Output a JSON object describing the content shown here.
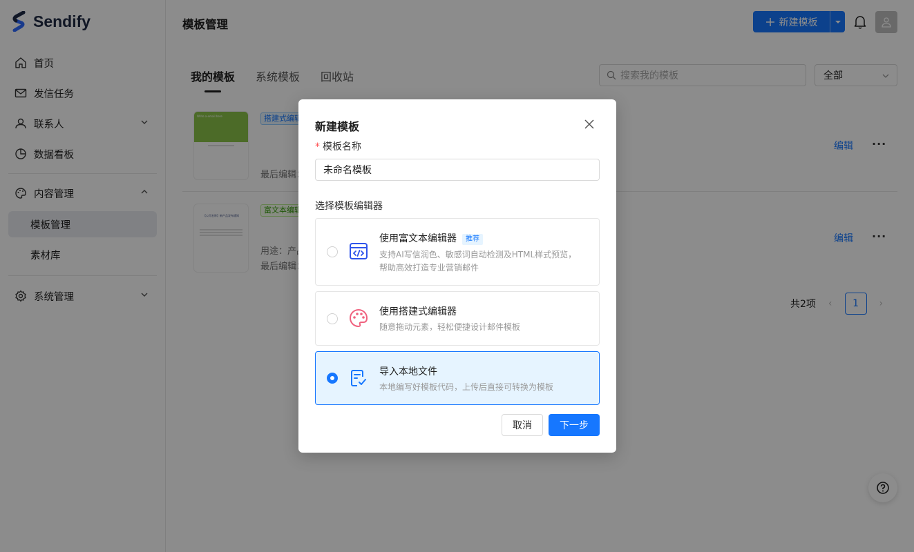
{
  "brand": {
    "name": "Sendify",
    "colors": {
      "primary": "#1677ff",
      "logo_dark": "#1f2a44",
      "logo_blue": "#2f6bff"
    }
  },
  "sidebar": {
    "items": [
      {
        "label": "首页",
        "icon": "home-icon"
      },
      {
        "label": "发信任务",
        "icon": "mail-icon"
      },
      {
        "label": "联系人",
        "icon": "user-icon"
      },
      {
        "label": "数据看板",
        "icon": "pie-chart-icon"
      },
      {
        "label": "内容管理",
        "icon": "palette-icon"
      },
      {
        "label": "模板管理"
      },
      {
        "label": "素材库"
      },
      {
        "label": "系统管理",
        "icon": "gear-icon"
      }
    ]
  },
  "header": {
    "title": "模板管理",
    "new_button_label": "新建模板"
  },
  "tabs": [
    {
      "label": "我的模板",
      "active": true
    },
    {
      "label": "系统模板"
    },
    {
      "label": "回收站"
    }
  ],
  "search": {
    "placeholder": "搜索我的模板"
  },
  "filter": {
    "value": "全部"
  },
  "templates": [
    {
      "tag": "搭建式编辑器",
      "meta": "最后编辑：",
      "edit_label": "编辑",
      "thumb_text": "Write a email here"
    },
    {
      "tag": "富文本编辑器",
      "usage": "用途：产品",
      "meta": "最后编辑：",
      "edit_label": "编辑",
      "thumb_text": "【公司名称】新产品发布通知"
    }
  ],
  "pagination": {
    "total": "共2项",
    "page": "1"
  },
  "modal": {
    "title": "新建模板",
    "name_label": "模板名称",
    "name_value": "未命名模板",
    "editor_label": "选择模板编辑器",
    "options": [
      {
        "title": "使用富文本编辑器",
        "badge": "推荐",
        "desc": "支持AI写信润色、敏感词自动检测及HTML样式预览，帮助高效打造专业营销邮件",
        "icon": "code-window-icon",
        "selected": false
      },
      {
        "title": "使用搭建式编辑器",
        "desc": "随意拖动元素，轻松便捷设计邮件模板",
        "icon": "palette-icon",
        "selected": false
      },
      {
        "title": "导入本地文件",
        "desc": "本地编写好模板代码，上传后直接可转换为模板",
        "icon": "file-import-icon",
        "selected": true
      }
    ],
    "cancel_label": "取消",
    "next_label": "下一步"
  }
}
